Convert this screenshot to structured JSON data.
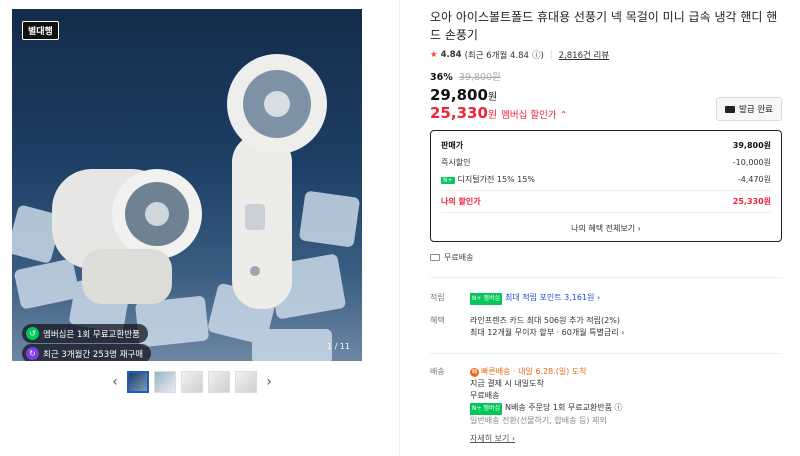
{
  "gallery": {
    "badge": "별대행",
    "counter": "1 / 11",
    "pill1": "멤버십은 1회 무료교환반품",
    "pill2": "최근 3개월간 253명 재구매"
  },
  "thumbs_prev": "‹",
  "thumbs_next": "›",
  "product": {
    "title": "오아 아이스볼트폴드 휴대용 선풍기 넥 목걸이 미니 급속 냉각 핸디 핸드 손풍기",
    "rating": "4.84",
    "rating_recent": "(최근 6개월 4.84",
    "rating_info": "ⓘ)",
    "review_count": "2,816건 리뷰",
    "discount_pct": "36%",
    "original_price": "39,800원",
    "price": "29,800",
    "price_unit": "원",
    "member_price": "25,330",
    "member_unit": "원",
    "member_label": "멤버십 할인가 ⌃",
    "coupon_button": "발급 완료"
  },
  "pricebox": {
    "rows": [
      {
        "label": "판매가",
        "value": "39,800원"
      },
      {
        "label": "즉시할인",
        "value": "-10,000원"
      },
      {
        "label": "디지털가전 15% 15%",
        "value": "-4,470원"
      },
      {
        "label": "나의 할인가",
        "value": "25,330원"
      }
    ],
    "np_badge": "N+",
    "more": "나의 혜택 전체보기 ›"
  },
  "shipping_free": "무료배송",
  "rows": {
    "points_key": "적립",
    "points_badge": "N+ 멤버십",
    "points_value": "최대 적립 포인트 3,161원 ›",
    "benefit_key": "혜택",
    "benefit_line1": "라인프렌즈 카드 최대 506원 추가 적립(2%)",
    "benefit_line2": "최대 12개월 무이자 할부 · 60개월 특별금리 ›",
    "delivery_key": "배송",
    "delivery_fast": "빠",
    "delivery_fast_label": "빠른배송",
    "delivery_date": " · 내일 6.28.(일) 도착",
    "delivery_line2": "지금 결제 시 내일도착",
    "delivery_line3": "무료배송",
    "delivery_badge": "N+ 멤버십",
    "delivery_line4": "N배송 주문당 1회 무료교환반품 ⓘ",
    "delivery_line5": "일반배송 전환(선물하기, 합배송 등) 제외",
    "delivery_more": "자세히 보기 ›"
  }
}
